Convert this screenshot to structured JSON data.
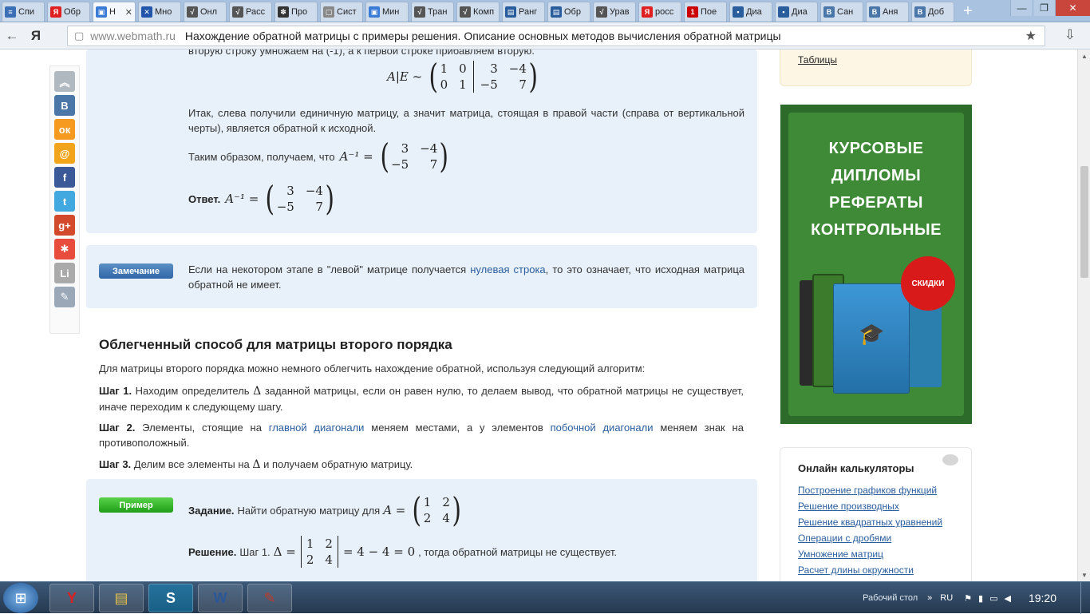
{
  "tabs": [
    {
      "label": "Спи",
      "color": "#3b6fb6",
      "g": "≡"
    },
    {
      "label": "Обр",
      "color": "#e02020",
      "g": "Я"
    },
    {
      "label": "Н",
      "color": "#3a7bd5",
      "g": "▣",
      "active": true
    },
    {
      "label": "Мно",
      "color": "#2255aa",
      "g": "✕"
    },
    {
      "label": "Онл",
      "color": "#555555",
      "g": "√"
    },
    {
      "label": "Расс",
      "color": "#555555",
      "g": "√"
    },
    {
      "label": "Про",
      "color": "#333333",
      "g": "✽"
    },
    {
      "label": "Сист",
      "color": "#888888",
      "g": "▢"
    },
    {
      "label": "Мин",
      "color": "#3a7bd5",
      "g": "▣"
    },
    {
      "label": "Тран",
      "color": "#555555",
      "g": "√"
    },
    {
      "label": "Комп",
      "color": "#555555",
      "g": "√"
    },
    {
      "label": "Ранг",
      "color": "#2a5d9c",
      "g": "▤"
    },
    {
      "label": "Обр",
      "color": "#2a5d9c",
      "g": "▤"
    },
    {
      "label": "Урав",
      "color": "#555555",
      "g": "√"
    },
    {
      "label": "росс",
      "color": "#e02020",
      "g": "Я"
    },
    {
      "label": "Пое",
      "color": "#cc0000",
      "g": "1"
    },
    {
      "label": "Диа",
      "color": "#2a5d9c",
      "g": "▪"
    },
    {
      "label": "Диа",
      "color": "#2a5d9c",
      "g": "▪"
    },
    {
      "label": "Сан",
      "color": "#4a76a8",
      "g": "В"
    },
    {
      "label": "Аня",
      "color": "#4a76a8",
      "g": "В"
    },
    {
      "label": "Доб",
      "color": "#4a76a8",
      "g": "В"
    }
  ],
  "newtab": "+",
  "window": {
    "min": "—",
    "max": "❐",
    "close": "✕"
  },
  "nav": {
    "back": "←",
    "logo": "Я"
  },
  "address": {
    "domain": "www.webmath.ru",
    "title": "Нахождение обратной матрицы с примеры решения. Описание основных методов вычисления обратной матрицы",
    "star": "★",
    "download": "⇩"
  },
  "share": [
    {
      "g": "︽",
      "color": "#b0b8c0"
    },
    {
      "g": "В",
      "color": "#4a76a8"
    },
    {
      "g": "ок",
      "color": "#f59a1f"
    },
    {
      "g": "@",
      "color": "#f2a51a"
    },
    {
      "g": "f",
      "color": "#3b5998"
    },
    {
      "g": "t",
      "color": "#41a9e0"
    },
    {
      "g": "g+",
      "color": "#d3492c"
    },
    {
      "g": "✱",
      "color": "#e84c3d"
    },
    {
      "g": "Li",
      "color": "#aaaaaa"
    },
    {
      "g": "✎",
      "color": "#9aa8b8"
    }
  ],
  "top_text": "вторую строку умножаем на (-1), а к первой строке прибавляем вторую.",
  "ae": {
    "lhs": "A|E ~",
    "left": [
      [
        "1",
        "0"
      ],
      [
        "0",
        "1"
      ]
    ],
    "right": [
      [
        "3",
        "−4"
      ],
      [
        "−5",
        "7"
      ]
    ]
  },
  "p1": "Итак, слева получили единичную матрицу, а значит матрица, стоящая в правой части (справа от вертикальной черты), является обратной к исходной.",
  "p2": {
    "text": "Таким образом, получаем, что",
    "lhs": "A⁻¹ =",
    "m": [
      [
        "3",
        "−4"
      ],
      [
        "−5",
        "7"
      ]
    ]
  },
  "answer": {
    "label": "Ответ.",
    "lhs": "A⁻¹ =",
    "m": [
      [
        "3",
        "−4"
      ],
      [
        "−5",
        "7"
      ]
    ]
  },
  "note": {
    "badge": "Замечание",
    "t1": "Если на некотором этапе в \"левой\" матрице получается",
    "link": "нулевая строка",
    "t2": ", то это означает, что исходная матрица обратной не имеет."
  },
  "h2": "Облегченный способ для матрицы второго порядка",
  "intro": "Для матрицы второго порядка можно немного облегчить нахождение обратной, используя следующий алгоритм:",
  "step1": {
    "label": "Шаг 1.",
    "t1": "Находим определитель",
    "sym": "Δ",
    "t2": "заданной матрицы, если он равен нулю, то делаем вывод, что обратной матрицы не существует, иначе переходим к следующему шагу."
  },
  "step2": {
    "label": "Шаг 2.",
    "t1": "Элементы, стоящие на",
    "l1": "главной диагонали",
    "t2": "меняем местами, а у элементов",
    "l2": "побочной диагонали",
    "t3": "меняем знак на противоположный."
  },
  "step3": {
    "label": "Шаг 3.",
    "t1": "Делим все элементы на",
    "sym": "Δ",
    "t2": "и получаем обратную матрицу."
  },
  "example": {
    "badge": "Пример",
    "task_label": "Задание.",
    "task": "Найти обратную матрицу для",
    "lhs": "A =",
    "m": [
      [
        "1",
        "2"
      ],
      [
        "2",
        "4"
      ]
    ],
    "sol_label": "Решение.",
    "sol_step": "Шаг 1.",
    "sol_lhs": "Δ =",
    "sol_rhs": "= 4 − 4 = 0",
    "sol_end": ", тогда обратной матрицы не существует."
  },
  "side": {
    "tables": "Таблицы",
    "calc_header": "Онлайн калькуляторы",
    "links": [
      "Построение графиков функций",
      "Решение производных",
      "Решение квадратных уравнений",
      "Операции с дробями",
      "Умножение матриц",
      "Расчет длины окружности"
    ]
  },
  "ad": {
    "lines": [
      "КУРСОВЫЕ",
      "ДИПЛОМЫ",
      "РЕФЕРАТЫ",
      "КОНТРОЛЬНЫЕ"
    ],
    "seal": "СКИДКИ"
  },
  "taskbar": {
    "desktop": "Рабочий стол",
    "lang": "RU",
    "time": "19:20",
    "apps": [
      {
        "g": "Y",
        "color": "#e02020"
      },
      {
        "g": "▤",
        "color": "#e8c34a"
      },
      {
        "g": "S",
        "color": "#00a6e8"
      },
      {
        "g": "W",
        "color": "#2b5797"
      },
      {
        "g": "✎",
        "color": "#c0392b"
      }
    ]
  }
}
